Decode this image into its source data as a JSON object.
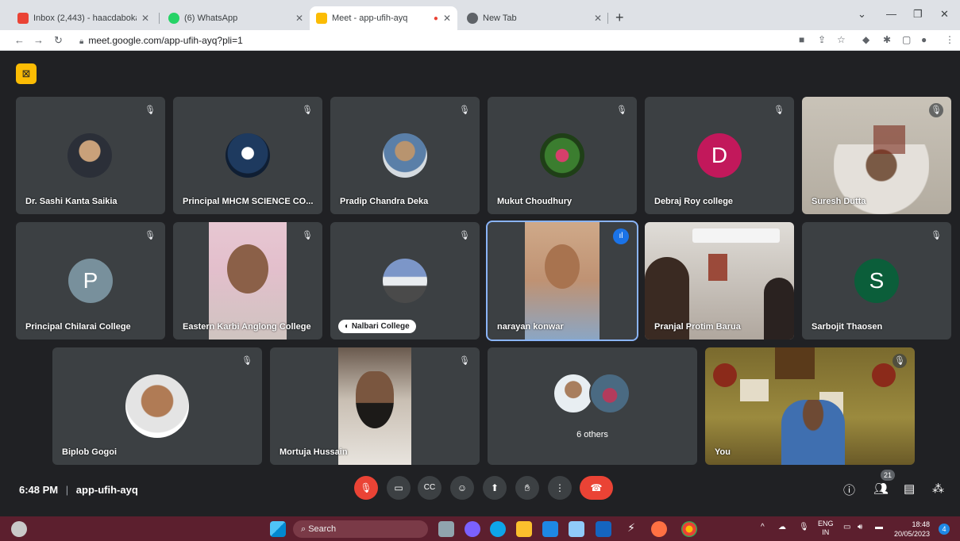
{
  "browser": {
    "tabs": [
      {
        "title": "Inbox (2,443) - haacdaboka@gm",
        "color": "#ea4335"
      },
      {
        "title": "(6) WhatsApp",
        "color": "#25d366"
      },
      {
        "title": "Meet - app-ufih-ayq",
        "color": "#fbbc04"
      },
      {
        "title": "New Tab",
        "color": "#5f6368"
      }
    ],
    "url": "meet.google.com/app-ufih-ayq?pli=1"
  },
  "participants_row1": [
    {
      "name": "Dr. Sashi Kanta Saikia"
    },
    {
      "name": "Principal MHCM SCIENCE CO..."
    },
    {
      "name": "Pradip Chandra Deka"
    },
    {
      "name": "Mukut Choudhury"
    },
    {
      "name": "Debraj Roy college",
      "letter": "D",
      "color": "#c2185b"
    },
    {
      "name": "Suresh Dutta"
    }
  ],
  "participants_row2": [
    {
      "name": "Principal Chilarai College",
      "letter": "P",
      "color": "#78909c"
    },
    {
      "name": "Eastern Karbi Anglong College"
    },
    {
      "name": "Nalbari College"
    },
    {
      "name": "narayan konwar"
    },
    {
      "name": "Pranjal Protim Barua"
    },
    {
      "name": "Sarbojit Thaosen",
      "letter": "S",
      "color": "#0b5e3a"
    }
  ],
  "participants_row3": [
    {
      "name": "Biplob Gogoi"
    },
    {
      "name": "Mortuja Hussain"
    },
    {
      "name": "6 others"
    },
    {
      "name": "You"
    }
  ],
  "footer": {
    "time": "6:48 PM",
    "separator": "|",
    "meeting_code": "app-ufih-ayq",
    "participant_count": "21"
  },
  "taskbar": {
    "search_label": "Search",
    "lang": "ENG",
    "region": "IN",
    "clock_time": "18:48",
    "clock_date": "20/05/2023",
    "notif": "4"
  }
}
